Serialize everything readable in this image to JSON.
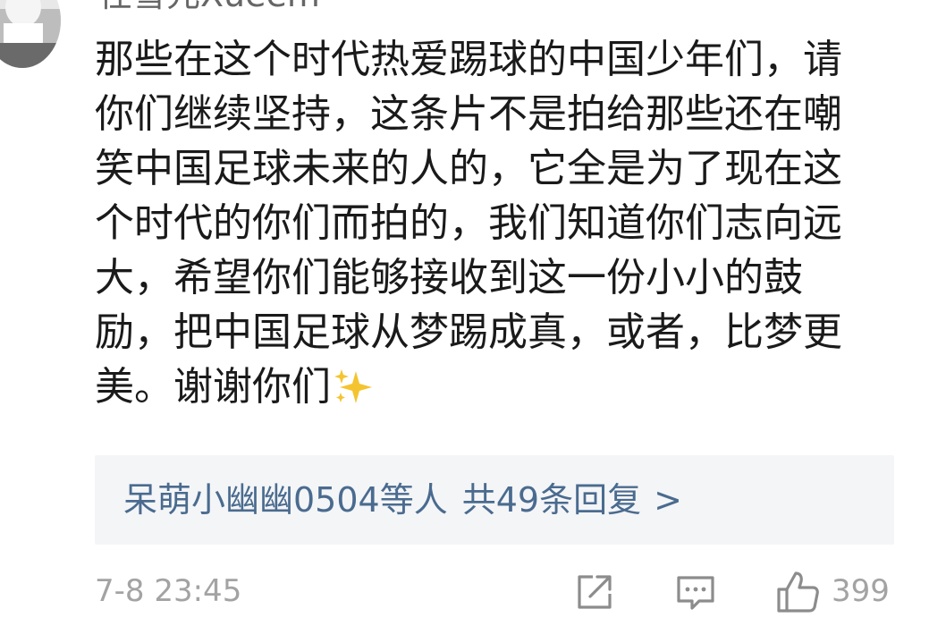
{
  "comment": {
    "author": {
      "name": "任雪元Xueem",
      "avatar_icon": "avatar-photo"
    },
    "text": "那些在这个时代热爱踢球的中国少年们，请\n你们继续坚持，这条片不是拍给那些还在嘲\n笑中国足球未来的人的，它全是为了现在这\n个时代的你们而拍的，我们知道你们志向远\n大，希望你们能够接收到这一份小小的鼓\n励，把中国足球从梦踢成真，或者，比梦更\n美。谢谢你们",
    "emoji_icon": "sparkles-icon",
    "replies": {
      "names": "呆萌小幽幽0504等人",
      "count_text": "共49条回复",
      "chevron": ">"
    },
    "timestamp": "7-8 23:45",
    "actions": {
      "share_icon": "share-icon",
      "comment_icon": "comment-icon",
      "like_icon": "thumbs-up-icon",
      "like_count": "399"
    }
  },
  "colors": {
    "text": "#1a1a1a",
    "link": "#4a6b8f",
    "meta": "#a3a3a3",
    "reply_bg": "#f4f5f7",
    "sparkle": "#f4c430"
  }
}
